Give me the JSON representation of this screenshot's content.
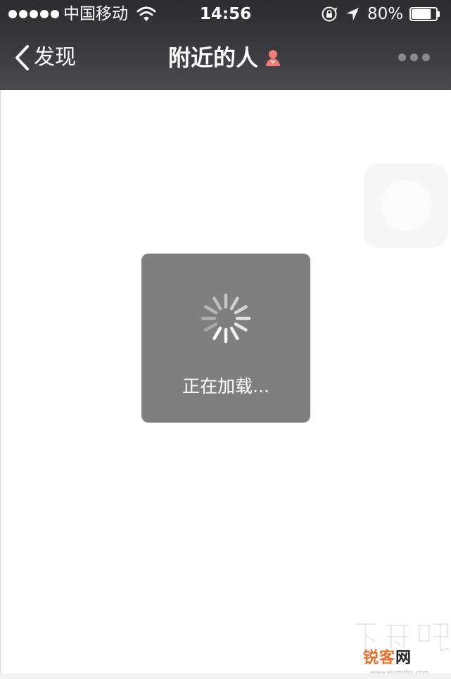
{
  "status_bar": {
    "signal_icon": "signal-dots-icon",
    "carrier": "中国移动",
    "wifi_icon": "wifi-icon",
    "time": "14:56",
    "orientation_lock_icon": "orientation-lock-icon",
    "location_icon": "location-arrow-icon",
    "battery_percent": "80%",
    "battery_level": 0.8
  },
  "nav": {
    "back_label": "发现",
    "back_icon": "chevron-left-icon",
    "title": "附近的人",
    "gender_icon": "female-icon",
    "gender_icon_color": "#f07b7b",
    "more_icon": "more-dots-icon"
  },
  "loading": {
    "text": "正在加载...",
    "spinner_icon": "spinner-icon"
  },
  "watermark": {
    "top_text": "下载吧",
    "badge_part1": "锐客",
    "badge_part2": "网",
    "url": "www.xiazaiba.com"
  },
  "colors": {
    "nav_background": "#3b3b3f",
    "hud_background": "#7f7f7f",
    "page_background": "#ffffff"
  }
}
